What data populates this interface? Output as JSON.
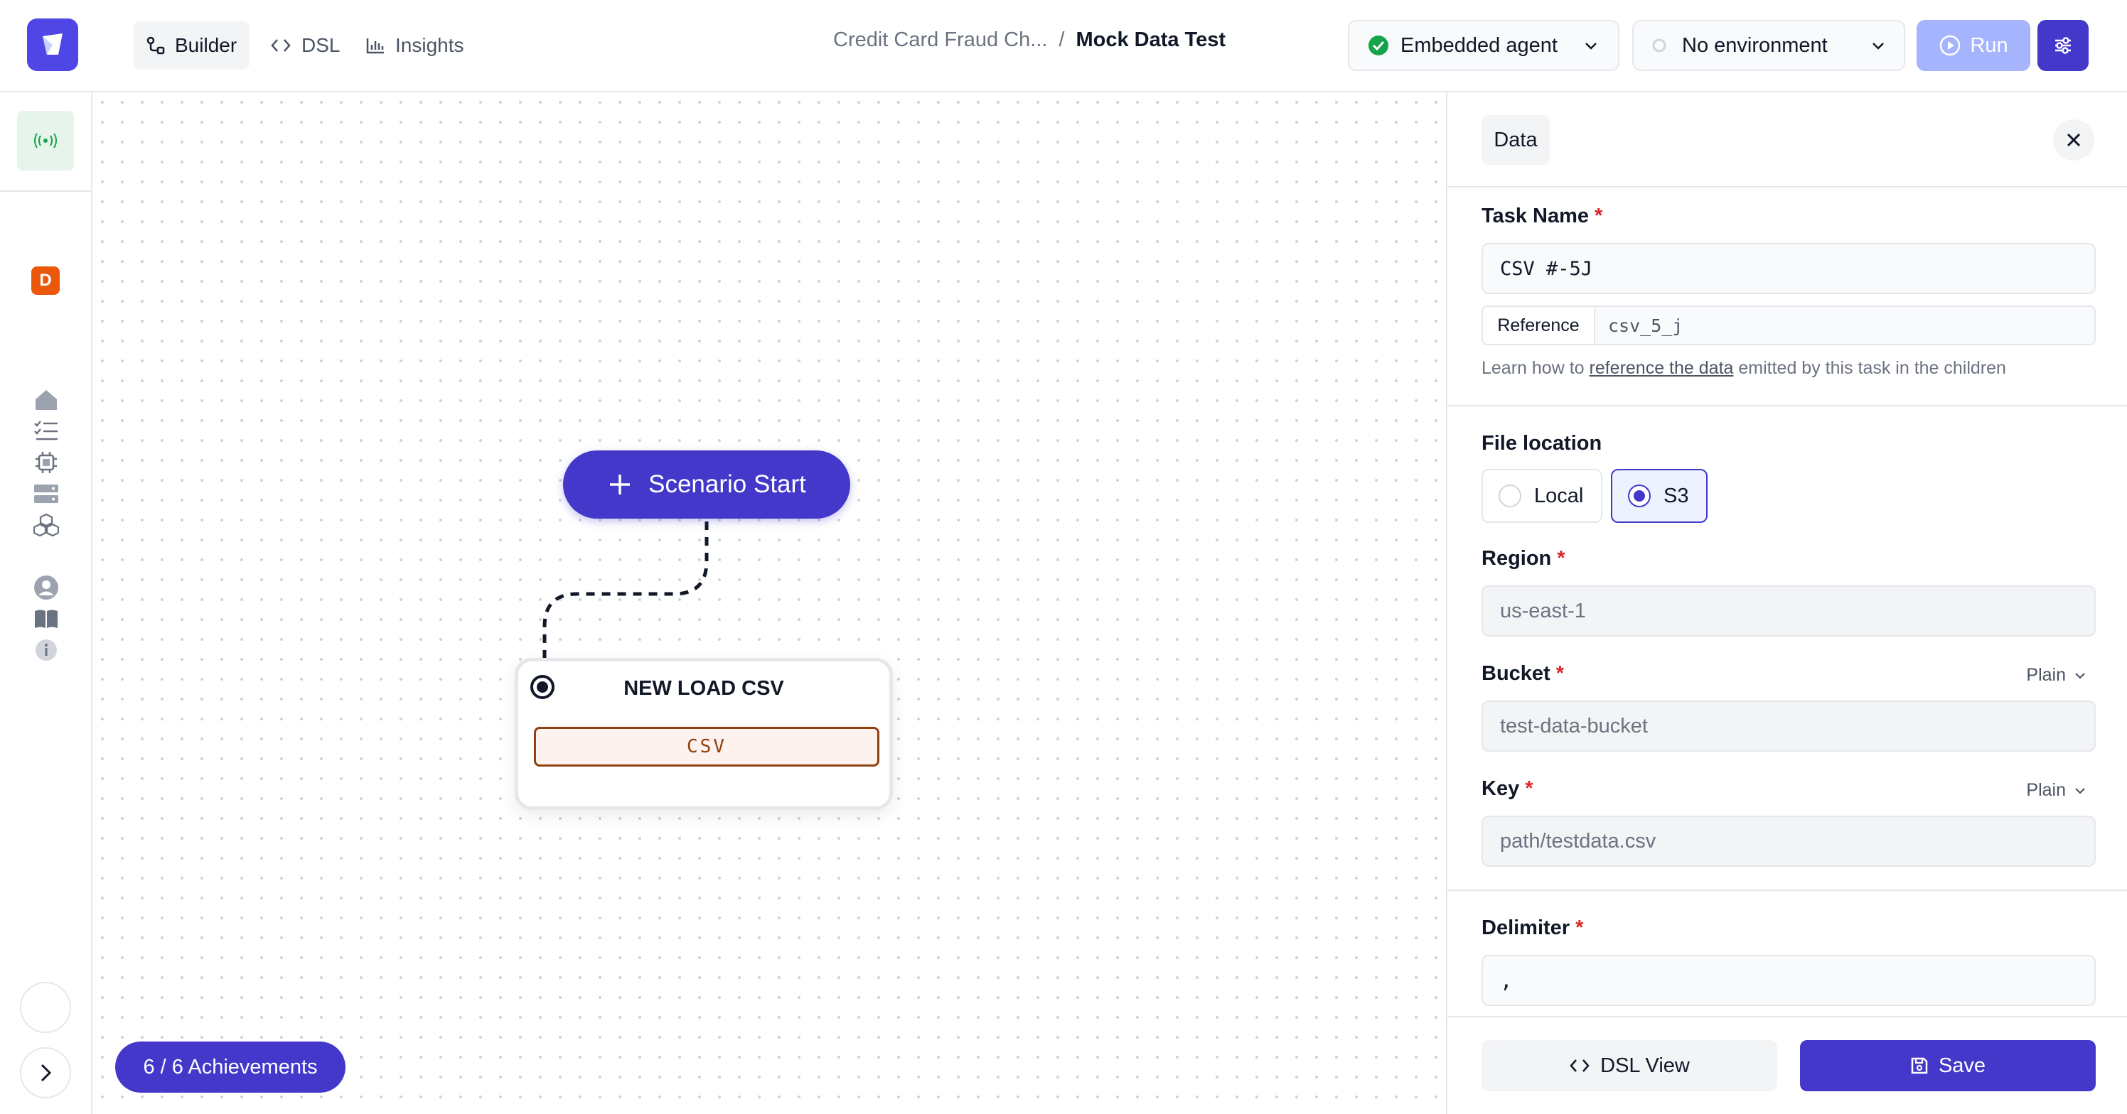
{
  "nav": {
    "tabs": [
      {
        "label": "Builder",
        "icon": "workflow-icon"
      },
      {
        "label": "DSL",
        "icon": "code-icon"
      },
      {
        "label": "Insights",
        "icon": "bar-chart-icon"
      }
    ]
  },
  "breadcrumb": {
    "parent": "Credit Card Fraud Ch...",
    "separator": "/",
    "current": "Mock Data Test"
  },
  "agent_select": {
    "label": "Embedded agent",
    "status_color": "#16a34a"
  },
  "env_select": {
    "label": "No environment"
  },
  "run_button": {
    "label": "Run"
  },
  "sidebar": {
    "avatar_letter": "D",
    "items": [
      "broadcast-icon",
      "home-icon",
      "checklist-icon",
      "chip-icon",
      "server-icon",
      "modules-icon",
      "user-icon",
      "book-icon",
      "info-icon"
    ]
  },
  "canvas": {
    "start_button": "Scenario Start",
    "node_title": "NEW LOAD CSV",
    "node_tag": "CSV",
    "achievements": "6 / 6 Achievements"
  },
  "panel": {
    "tab": "Data",
    "task_name_label": "Task Name",
    "task_name_value": "CSV #-5J",
    "reference_label": "Reference",
    "reference_value": "csv_5_j",
    "help_prefix": "Learn how to ",
    "help_link": "reference the data",
    "help_suffix": " emitted by this task in the children",
    "file_location_label": "File location",
    "options": [
      "Local",
      "S3"
    ],
    "selected_option": "S3",
    "region_label": "Region",
    "region_placeholder": "us-east-1",
    "bucket_label": "Bucket",
    "bucket_placeholder": "test-data-bucket",
    "bucket_mode": "Plain",
    "key_label": "Key",
    "key_placeholder": "path/testdata.csv",
    "key_mode": "Plain",
    "delimiter_label": "Delimiter",
    "delimiter_value": ",",
    "required_mark": "*",
    "dsl_view_button": "DSL View",
    "save_button": "Save"
  },
  "colors": {
    "accent": "#4338ca",
    "accent_light": "#a5b4fc",
    "required": "#dc2626"
  }
}
